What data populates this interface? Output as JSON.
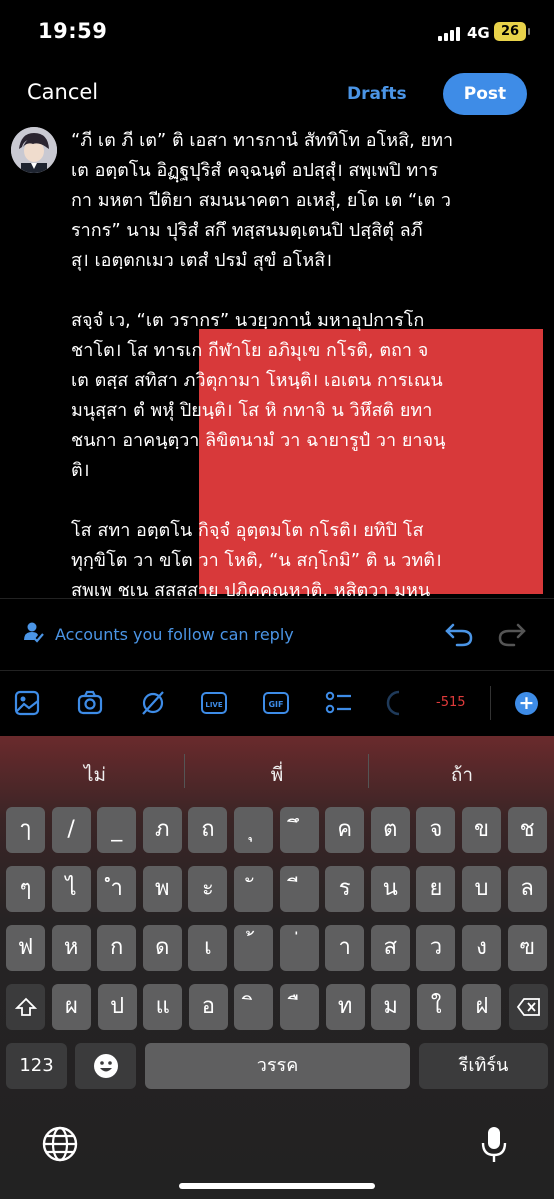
{
  "status": {
    "time": "19:59",
    "network": "4G",
    "battery": "26"
  },
  "header": {
    "cancel": "Cancel",
    "drafts": "Drafts",
    "post": "Post"
  },
  "compose": {
    "para1": [
      "“ภี เต ภี เต” ติ เอสา ทารกานํ สัททิโท อโหสิ, ยทา",
      "เต อตฺตโน อิฏฺฐปุริสํ คจฺฉนฺตํ อปสฺสุํ। สพฺเพปิ ทาร",
      "กา มหตา ปีติยา สมนนาคตา อเหสุํ, ยโต เต “เต ว",
      "รากร” นาม ปุริสํ สกึ ทสฺสนมตฺเตนปิ ปสฺสิตุํ ลภึ",
      "สุ। เอตฺตกเมว เตสํ ปรมํ สุขํ อโหสิ।"
    ],
    "para2": [
      "สจฺจํ เว, “เต วรากร” นวยฺวกานํ มหาอุปการโก",
      "ชาโต। โส ทารเก กีฬาโย อภิมุเข กโรติ, ตถา จ",
      "เต ตสฺส สทิสา ภวิตุกามา โหนฺติ। เอเตน การเณน",
      "มนุสฺสา ตํ พหุํ ปิยนฺติ। โส หิ กทาจิ น วิหึสติ ยทา",
      "ชนกา อาคนฺตฺวา ลิขิตนามํ วา ฉายารูปํ วา ยาจนฺ",
      "ติ।"
    ],
    "para3": [
      "โส สทา อตฺตโน กิจฺจํ อุตฺตมโต กโรติ। ยทิปิ โส",
      "ทุกฺขิโต วา ขโต วา โหติ, “น สกฺโกมิ” ติ น วทติ।",
      "สพฺเพ ชเน สุสฺสูสาย ปฏิคฺคณฺหาติ, หสิตฺวา มหนฺ"
    ]
  },
  "reply": {
    "label": "Accounts you follow can reply"
  },
  "toolbar": {
    "icons": [
      "image-icon",
      "camera-icon",
      "gif-search-icon",
      "live-icon",
      "gif-icon",
      "poll-icon"
    ],
    "live": "LIVE",
    "gif": "GIF",
    "char_count": "-515"
  },
  "keyboard": {
    "suggestions": [
      "ไม่",
      "พี่",
      "ถ้า"
    ],
    "row1": [
      "ๅ",
      "/",
      "_",
      "ภ",
      "ถ",
      "ุ",
      "ึ",
      "ค",
      "ต",
      "จ",
      "ข",
      "ช"
    ],
    "row2": [
      "ๆ",
      "ไ",
      "ำ",
      "พ",
      "ะ",
      "ั",
      "ี",
      "ร",
      "น",
      "ย",
      "บ",
      "ล"
    ],
    "row3": [
      "ฟ",
      "ห",
      "ก",
      "ด",
      "เ",
      "้",
      "่",
      "า",
      "ส",
      "ว",
      "ง",
      "ฃ"
    ],
    "row4": [
      "ผ",
      "ป",
      "แ",
      "อ",
      "ิ",
      "ื",
      "ท",
      "ม",
      "ใ",
      "ฝ"
    ],
    "numbers": "123",
    "space": "วรรค",
    "return": "รีเทิร์น"
  },
  "colors": {
    "accent": "#3e8ce7",
    "link": "#4b95e6",
    "highlight": "#d8393a",
    "warning": "#e03b3b",
    "battery": "#e8d24a"
  }
}
